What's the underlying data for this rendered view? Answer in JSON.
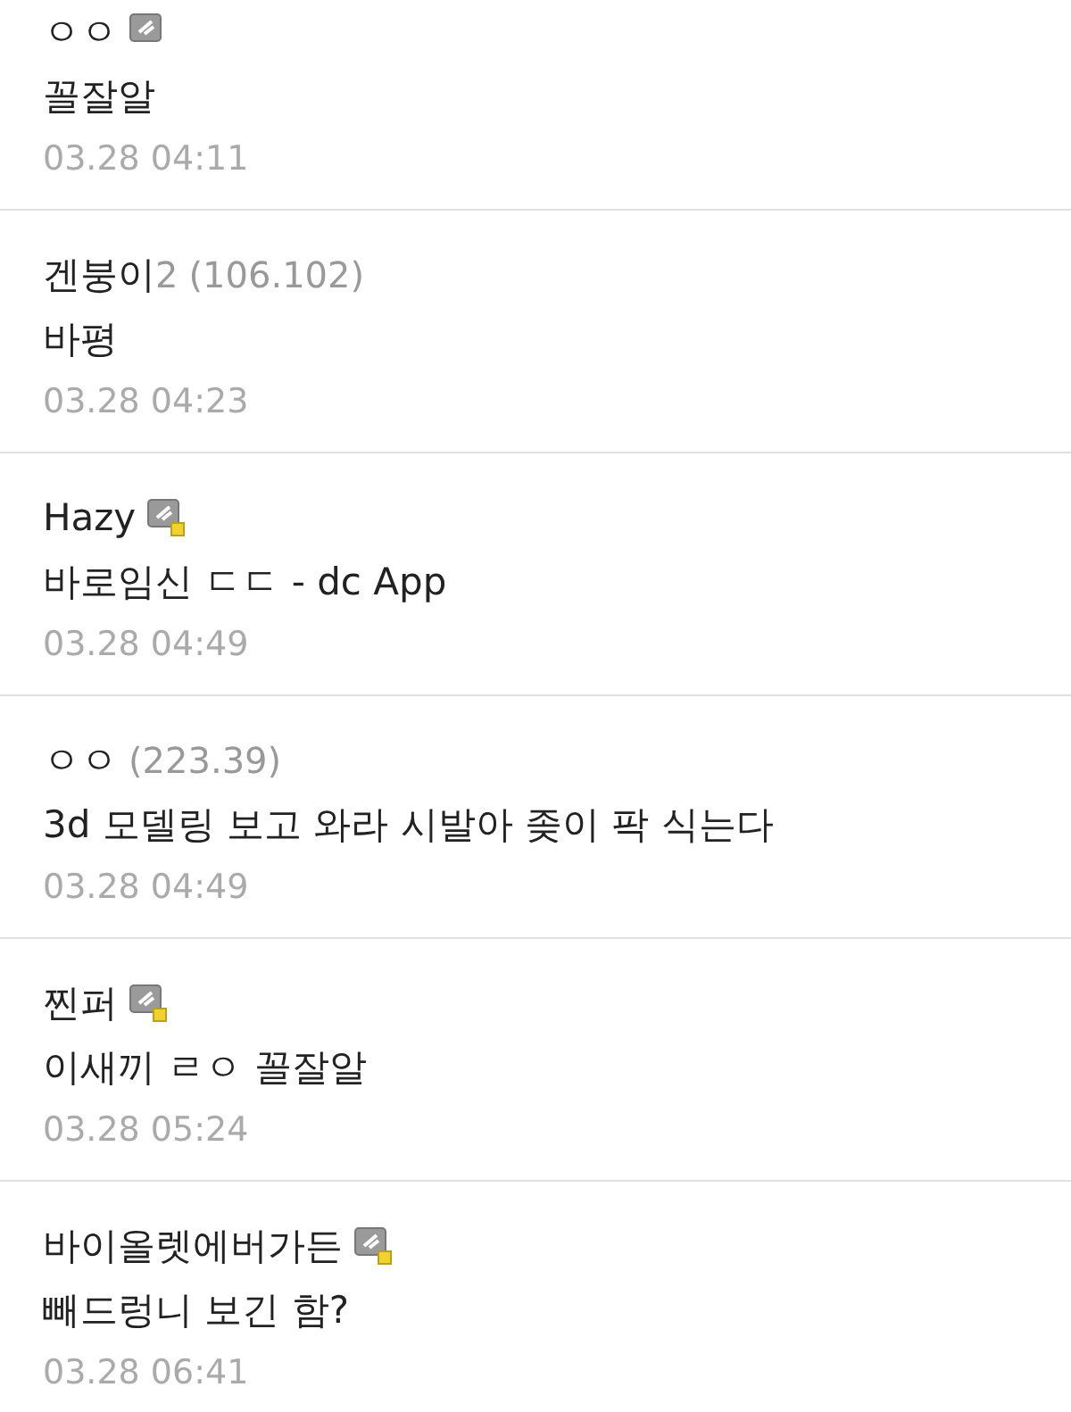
{
  "comments": [
    {
      "kind": "gallog",
      "name": "ㅇㅇ",
      "text": "꼴잘알",
      "time": "03.28 04:11"
    },
    {
      "kind": "guest",
      "name": "겐붕이",
      "suffix": "2",
      "ip": "(106.102)",
      "text": "바평",
      "time": "03.28 04:23"
    },
    {
      "kind": "gallog_semi",
      "name": "Hazy",
      "text": "바로임신 ㄷㄷ - dc App",
      "time": "03.28 04:49"
    },
    {
      "kind": "guest",
      "name": "ㅇㅇ",
      "ip": "(223.39)",
      "text": "3d 모델링 보고 와라 시발아 좆이 팍 식는다",
      "time": "03.28 04:49"
    },
    {
      "kind": "gallog_semi",
      "name": "찐퍼",
      "text": "이새끼 ㄹㅇ 꼴잘알",
      "time": "03.28 05:24"
    },
    {
      "kind": "gallog_semi",
      "name": "바이올렛에버가든",
      "text": "빼드렁니 보긴 함?",
      "time": "03.28 06:41"
    }
  ]
}
